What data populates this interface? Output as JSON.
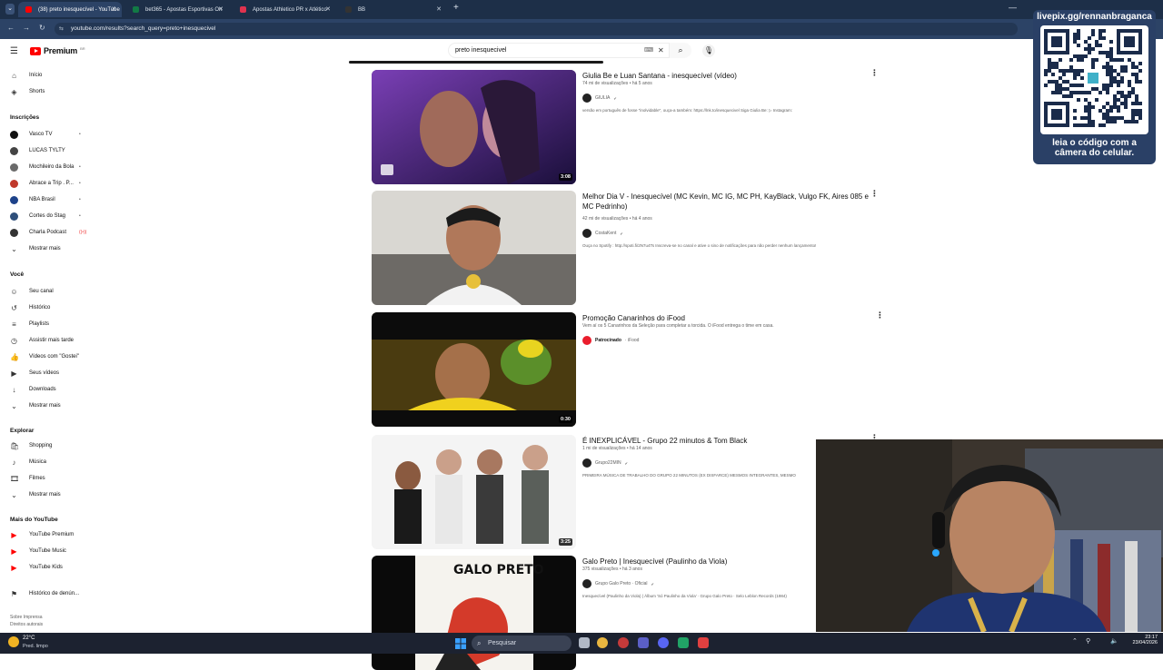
{
  "browser": {
    "tabs": [
      {
        "label": "(38) preto inesquecível - YouTube",
        "active": true,
        "icon": "youtube-icon",
        "color": "#ff0000"
      },
      {
        "label": "bet365 - Apostas Esportivas On",
        "active": false,
        "icon": "bet365-icon",
        "color": "#127a45"
      },
      {
        "label": "Apostas Athletico PR x Atlético",
        "active": false,
        "icon": "betting-icon",
        "color": "#e0334f"
      },
      {
        "label": "BB",
        "active": false,
        "icon": "bb-icon",
        "color": "#333333"
      }
    ],
    "url": "youtube.com/results?search_query=preto+inesquecivel"
  },
  "header": {
    "logo": "Premium",
    "logo_sup": "BR",
    "search_value": "preto inesquecivel"
  },
  "sidebar": {
    "top": [
      {
        "label": "Início",
        "icon": "home-icon"
      },
      {
        "label": "Shorts",
        "icon": "shorts-icon"
      }
    ],
    "subs_header": "Inscrições",
    "subs": [
      {
        "label": "Vasco TV",
        "color": "#111111",
        "dot": "•"
      },
      {
        "label": "LUCAS TYLTY",
        "color": "#444444",
        "dot": ""
      },
      {
        "label": "Mochileiro da Bola",
        "color": "#6a6a6a",
        "dot": "•"
      },
      {
        "label": "Abrace a Trip . P...",
        "color": "#c0392b",
        "dot": "•"
      },
      {
        "label": "NBA Brasil",
        "color": "#1d428a",
        "dot": "•"
      },
      {
        "label": "Cortes do Stag",
        "color": "#2e4f7a",
        "dot": "•"
      },
      {
        "label": "Charla Podcast",
        "color": "#333333",
        "dot": "((•))"
      },
      {
        "label": "Mostrar mais",
        "color": "",
        "dot": ""
      }
    ],
    "you_header": "Você",
    "you": [
      {
        "label": "Seu canal",
        "icon": "channel-icon"
      },
      {
        "label": "Histórico",
        "icon": "history-icon"
      },
      {
        "label": "Playlists",
        "icon": "playlists-icon"
      },
      {
        "label": "Assistir mais tarde",
        "icon": "watch-later-icon"
      },
      {
        "label": "Vídeos com \"Gostei\"",
        "icon": "like-icon"
      },
      {
        "label": "Seus vídeos",
        "icon": "your-videos-icon"
      },
      {
        "label": "Downloads",
        "icon": "download-icon"
      },
      {
        "label": "Mostrar mais",
        "icon": "chevron-down-icon"
      }
    ],
    "explore_header": "Explorar",
    "explore": [
      {
        "label": "Shopping",
        "icon": "shopping-icon"
      },
      {
        "label": "Música",
        "icon": "music-icon"
      },
      {
        "label": "Filmes",
        "icon": "movies-icon"
      },
      {
        "label": "Mostrar mais",
        "icon": "chevron-down-icon"
      }
    ],
    "more_header": "Mais do YouTube",
    "more": [
      {
        "label": "YouTube Premium"
      },
      {
        "label": "YouTube Music"
      },
      {
        "label": "YouTube Kids"
      }
    ],
    "report": "Histórico de denún...",
    "footer1": "Sobre  Imprensa",
    "footer2": "Direitos autorais"
  },
  "results": [
    {
      "title": "Giulia Be e Luan Santana - inesquecível (vídeo)",
      "meta": "74 mi de visualizações • há 5 anos",
      "channel": "GIULIA",
      "desc": "versão em português de fosse \"inolvidable\", ouça-a também: https://lnk.to/inesquecivel Siga Giulia Be: ▷ Instagram:",
      "duration": "3:08"
    },
    {
      "title": "Melhor Dia V - Inesquecível (MC Kevin, MC IG, MC PH, KayBlack, Vulgo FK, Aires 085 e MC Pedrinho)",
      "meta": "42 mi de visualizações • há 4 anos",
      "channel": "CostaKent",
      "desc": "Ouça no Spotify : http://spoti.fi/2N7u4Ts Inscreva-se no canal e ative o sino de notificações para não perder nenhum lançamento!",
      "duration": ""
    },
    {
      "title": "Promoção Canarinhos do iFood",
      "meta": "Vem aí os 5 Canarinhos da Seleção para completar a torcida. O iFood entrega o time em casa.",
      "channel": "Patrocinado",
      "channel_extra": "· iFood",
      "desc": "",
      "duration": "0:30"
    },
    {
      "title": "É INEXPLICÁVEL - Grupo 22 minutos & Tom Black",
      "meta": "1 mi de visualizações • há 14 anos",
      "channel": "Grupo22MIN",
      "desc": "PRIMEIRA MÚSICA DE TRABALHO DO GRUPO 22 MINUTOS (EX DISFARCE) MESMOS INTEGRANTES, MESMO",
      "duration": "3:25"
    },
    {
      "title": "Galo Preto | Inesquecível (Paulinho da Viola)",
      "meta": "375 visualizações • há 3 anos",
      "channel": "Grupo Galo Preto · Oficial",
      "desc": "Inesquecível (Paulinho da Viola) | Álbum 'Só Paulinho da Viola' · Grupo Galo Preto · Selo Leblon Records (1984)",
      "duration": "",
      "thumb_text": "GALO PRETO"
    }
  ],
  "overlay": {
    "qr_title": "livepix.gg/rennanbraganca",
    "qr_caption_1": "leia o código com a",
    "qr_caption_2": "câmera do celular."
  },
  "taskbar": {
    "weather_temp": "22°C",
    "weather_desc": "Pred. limpo",
    "search": "Pesquisar",
    "time": "23:17",
    "date": "23/04/2026"
  }
}
